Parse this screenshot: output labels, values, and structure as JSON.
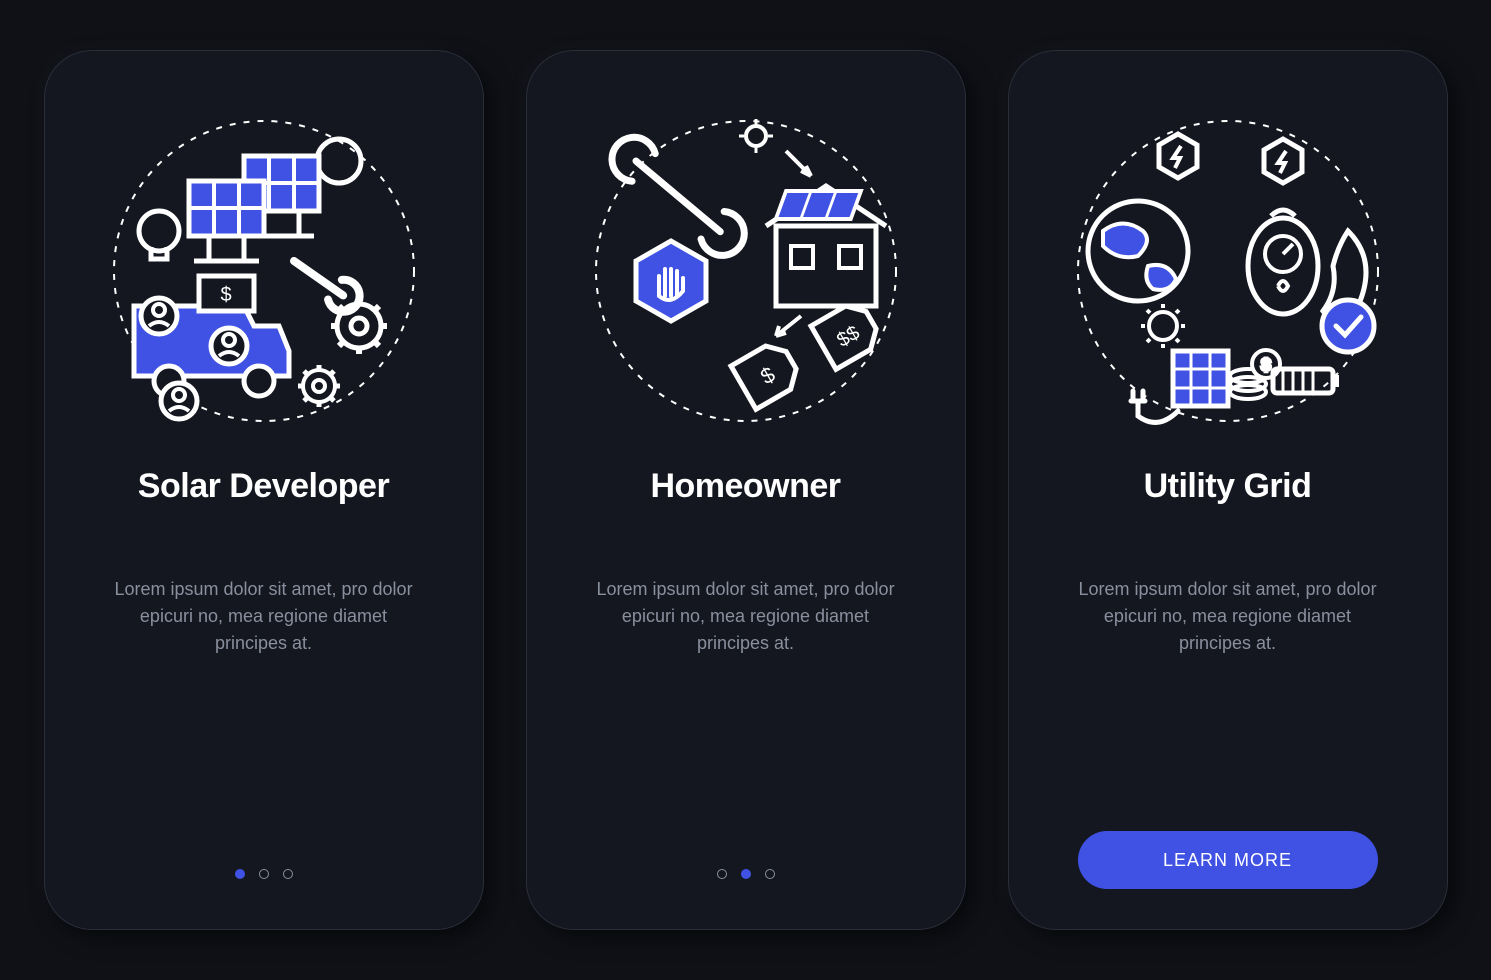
{
  "accent_color": "#3f52e3",
  "screens": [
    {
      "id": "solar-developer",
      "title": "Solar Developer",
      "description": "Lorem ipsum dolor sit amet, pro dolor epicuri no, mea regione diamet principes at.",
      "active_step": 0,
      "illustration": "solar-developer"
    },
    {
      "id": "homeowner",
      "title": "Homeowner",
      "description": "Lorem ipsum dolor sit amet, pro dolor epicuri no, mea regione diamet principes at.",
      "active_step": 1,
      "illustration": "homeowner"
    },
    {
      "id": "utility-grid",
      "title": "Utility Grid",
      "description": "Lorem ipsum dolor sit amet, pro dolor epicuri no, mea regione diamet principes at.",
      "active_step": 2,
      "illustration": "utility-grid",
      "cta_label": "LEARN MORE"
    }
  ],
  "total_steps": 3,
  "illustration_names": {
    "solar-developer": "solar-panels-team-wrench-icon",
    "homeowner": "wrench-hand-house-price-icon",
    "utility-grid": "globe-power-meter-icon"
  }
}
